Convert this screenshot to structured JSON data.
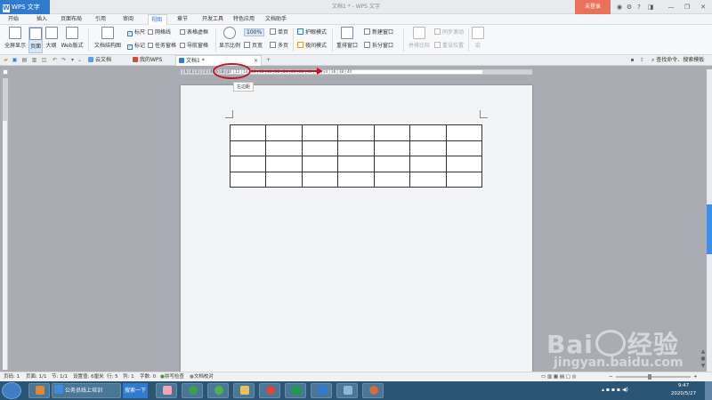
{
  "app": {
    "menu_label": "WPS 文字",
    "doc_title": "文档1 * - WPS 文字",
    "login_label": "未登录"
  },
  "menubar": {
    "tabs": [
      "开始",
      "插入",
      "页面布局",
      "引用",
      "审阅",
      "视图",
      "章节",
      "开发工具",
      "特色应用",
      "文档助手"
    ],
    "active": "视图"
  },
  "ribbon": {
    "full_screen": "全屏显示",
    "page_view": "页面",
    "outline_view": "大纲",
    "web_view": "Web版式",
    "doc_structure": "文档结构图",
    "ruler": "标尺",
    "gridlines": "网格线",
    "table_gridlines": "表格虚框",
    "marks": "标记",
    "task_pane": "任务窗格",
    "nav_pane": "导航窗格",
    "zoom": "显示比例",
    "zoom_value": "100%",
    "page_width": "页宽",
    "one_page": "单页",
    "multi_page": "多页",
    "eye_mode": "护眼模式",
    "night_mode": "夜间模式",
    "arrange": "重排窗口",
    "new_window": "新建窗口",
    "split": "拆分窗口",
    "side_by_side": "并排比较",
    "sync_scroll": "同步滚动",
    "reset_position": "重设位置",
    "macro": "宏"
  },
  "doctabs": [
    {
      "label": "云文档",
      "color": "#5aa0e6"
    },
    {
      "label": "我的WPS",
      "color": "#d9473f"
    },
    {
      "label": "文档1 *",
      "color": "#2f7bd0"
    }
  ],
  "find_label": "查找命令、搜索模板",
  "ruler": {
    "numbers": "| 6 | 4 | 2 |  | 2 | 4 | 6 | 8 | 10 | 12 | 14 | 16 | 18 | 20 | 22 | 24 | 26 | 28 | 30 | 32 | 34 | 36 | 38 | 40"
  },
  "table": {
    "rows": 4,
    "cols": 7
  },
  "tooltip": "左边距",
  "status": {
    "page_no": "页码: 1",
    "pages": "页面: 1/1",
    "section": "节: 1/1",
    "setting": "设置值: 6厘米",
    "row": "行: 5",
    "col": "列: 1",
    "words": "字数: 0",
    "spell": "拼写检查",
    "doc_check": "文档校对"
  },
  "taskbar": {
    "browser_task": "公务员线上培训",
    "search_btn": "搜索一下",
    "time": "9:47",
    "date": "2020/5/27"
  },
  "watermark": {
    "brand_left": "Bai",
    "brand_right": "经验",
    "url": "jingyan.baidu.com"
  }
}
